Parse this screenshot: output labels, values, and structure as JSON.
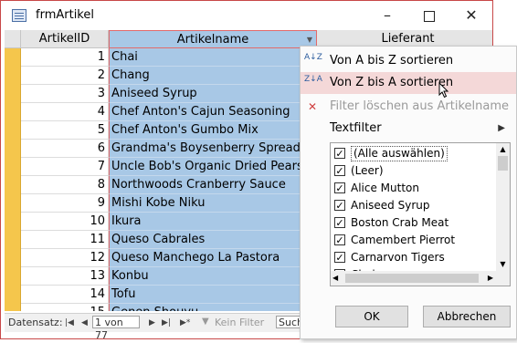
{
  "window": {
    "title": "frmArtikel"
  },
  "grid": {
    "headers": {
      "id": "ArtikelID",
      "name": "Artikelname",
      "supplier": "Lieferant"
    },
    "rows": [
      {
        "id": "1",
        "name": "Chai"
      },
      {
        "id": "2",
        "name": "Chang"
      },
      {
        "id": "3",
        "name": "Aniseed Syrup"
      },
      {
        "id": "4",
        "name": "Chef Anton's Cajun Seasoning"
      },
      {
        "id": "5",
        "name": "Chef Anton's Gumbo Mix"
      },
      {
        "id": "6",
        "name": "Grandma's Boysenberry Spread"
      },
      {
        "id": "7",
        "name": "Uncle Bob's Organic Dried Pears"
      },
      {
        "id": "8",
        "name": "Northwoods Cranberry Sauce"
      },
      {
        "id": "9",
        "name": "Mishi Kobe Niku"
      },
      {
        "id": "10",
        "name": "Ikura"
      },
      {
        "id": "11",
        "name": "Queso Cabrales"
      },
      {
        "id": "12",
        "name": "Queso Manchego La Pastora"
      },
      {
        "id": "13",
        "name": "Konbu"
      },
      {
        "id": "14",
        "name": "Tofu"
      },
      {
        "id": "15",
        "name": "Genen Shouyu"
      }
    ]
  },
  "navbar": {
    "label": "Datensatz:",
    "record": "1 von 77",
    "filter": "Kein Filter",
    "search": "Such"
  },
  "menu": {
    "sort_asc": "Von A bis Z sortieren",
    "sort_asc_icon": "A↓Z",
    "sort_desc": "Von Z bis A sortieren",
    "sort_desc_icon": "Z↓A",
    "clear_filter": "Filter löschen aus Artikelname",
    "text_filter": "Textfilter",
    "list": [
      "(Alle auswählen)",
      "(Leer)",
      "Alice Mutton",
      "Aniseed Syrup",
      "Boston Crab Meat",
      "Camembert Pierrot",
      "Carnarvon Tigers",
      "Chai"
    ],
    "ok": "OK",
    "cancel": "Abbrechen"
  },
  "colors": {
    "selection": "#a8c8e6",
    "record_selector": "#f5c64c",
    "hover": "#f4d8d8",
    "border_accent": "#e26a6a"
  }
}
